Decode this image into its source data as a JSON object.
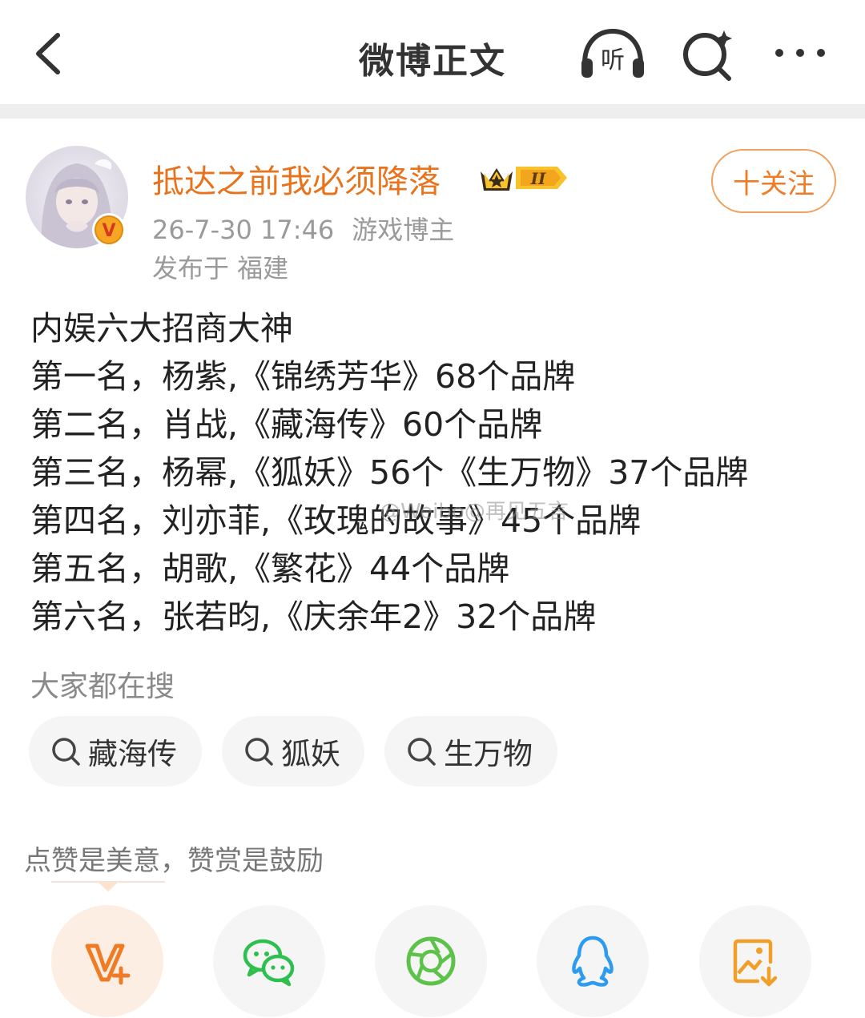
{
  "header": {
    "title": "微博正文",
    "listen_label": "听"
  },
  "author": {
    "name": "抵达之前我必须降落",
    "badge_level": "II",
    "badge_text": "V",
    "date": "26-7-30 17:46",
    "role": "游戏博主",
    "location": "发布于 福建"
  },
  "follow_button": {
    "label": "十关注"
  },
  "post": {
    "lines": [
      "内娱六大招商大神",
      "第一名，杨紫,《锦绣芳华》68个品牌",
      "第二名，肖战,《藏海传》60个品牌",
      "第三名，杨幂,《狐妖》56个《生万物》37个品牌",
      "第四名，刘亦菲,《玫瑰的故事》45个品牌",
      "第五名，胡歌,《繁花》44个品牌",
      "第六名，张若昀,《庆余年2》32个品牌"
    ],
    "watermark": "@Weibo@再见五言"
  },
  "search_section": {
    "title": "大家都在搜",
    "chips": [
      "藏海传",
      "狐妖",
      "生万物"
    ]
  },
  "reward": {
    "text": "点赞是美意，赞赏是鼓励"
  },
  "share": {
    "items": [
      "weibo-v-plus",
      "wechat",
      "moments",
      "qq",
      "save-image"
    ]
  },
  "colors": {
    "accent": "#ef7b24",
    "username": "#e8731c",
    "meta": "#9a9a9a",
    "chip_bg": "#f5f5f5",
    "wechat_green": "#2fbf4f",
    "moments_green": "#5cc24a",
    "qq_blue": "#2d9bf0",
    "save_orange": "#f0a028"
  }
}
